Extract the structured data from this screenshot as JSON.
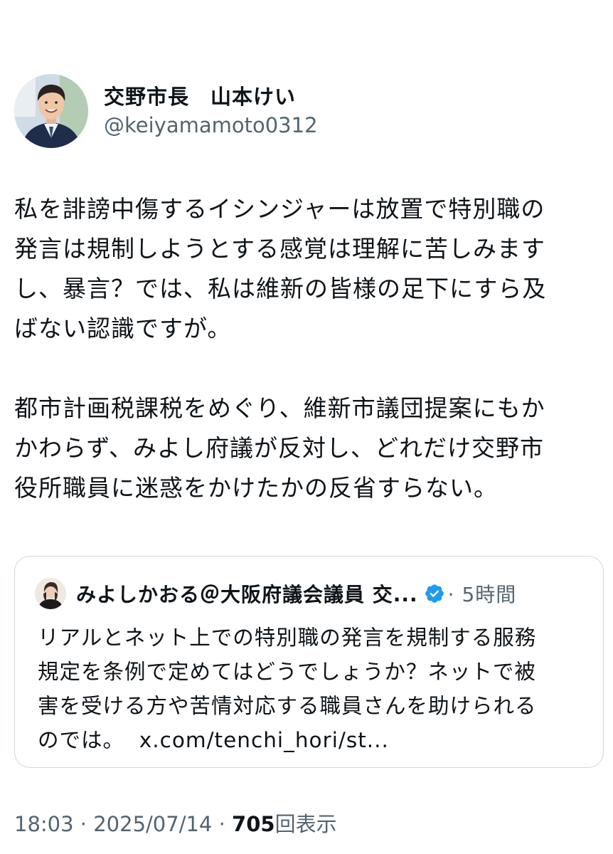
{
  "author": {
    "display_name": "交野市長　山本けい",
    "handle": "@keiyamamoto0312",
    "avatar_icon": "profile-photo"
  },
  "tweet": {
    "paragraphs": [
      {
        "lines": [
          "私を誹謗中傷するイシンジャーは放置で特別職の",
          "発言は規制しようとする感覚は理解に苦しみます",
          "し、暴言？では、私は維新の皆様の足下にすら及",
          "ばない認識ですが。"
        ]
      },
      {
        "lines": [
          "都市計画税課税をめぐり、維新市議団提案にもか",
          "かわらず、みよし府議が反対し、どれだけ交野市",
          "役所職員に迷惑をかけたかの反省すらない。"
        ]
      }
    ]
  },
  "quote": {
    "display_name": "みよしかおる＠大阪府議会議員 交...",
    "verified_icon": "verified-badge-icon",
    "time": "· 5時間",
    "lines": [
      "リアルとネット上での特別職の発言を規制する服務",
      "規定を条例で定めてはどうでしょうか？ネットで被",
      "害を受ける方や苦情対応する職員さんを助けられる"
    ],
    "last_line_text": "のでは。",
    "link": "x.com/tenchi_hori/st..."
  },
  "meta": {
    "time": "18:03",
    "separator": " · ",
    "date": "2025/07/14",
    "views_count": "705",
    "views_label": "回表示"
  },
  "colors": {
    "text": "#0f1419",
    "secondary": "#536471",
    "border": "#cfd9de",
    "verified": "#1d9bf0"
  }
}
